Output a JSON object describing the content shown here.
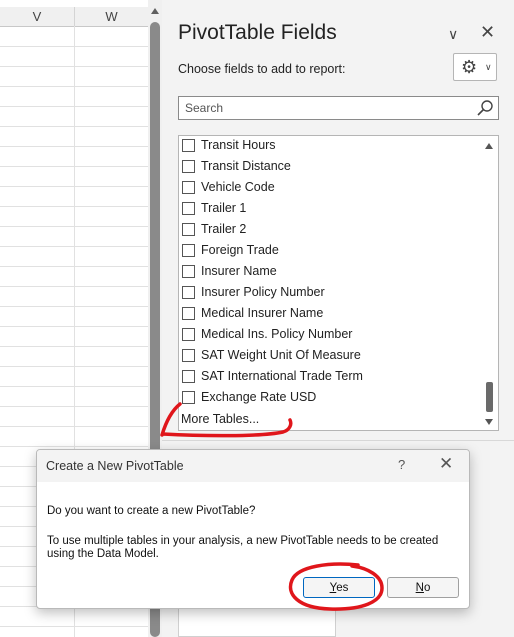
{
  "sheet": {
    "columns": [
      "V",
      "W"
    ]
  },
  "panel": {
    "title": "PivotTable Fields",
    "subtitle": "Choose fields to add to report:",
    "search_placeholder": "Search",
    "fields": [
      "Transit Hours",
      "Transit Distance",
      "Vehicle Code",
      "Trailer 1",
      "Trailer 2",
      "Foreign Trade",
      "Insurer Name",
      "Insurer Policy Number",
      "Medical Insurer Name",
      "Medical Ins. Policy Number",
      "SAT Weight Unit Of Measure",
      "SAT International Trade Term",
      "Exchange Rate USD"
    ],
    "more_tables": "More Tables..."
  },
  "dialog": {
    "title": "Create a New PivotTable",
    "help": "?",
    "question": "Do you want to create a new PivotTable?",
    "message": "To use multiple tables in your analysis, a new PivotTable needs to be created using the Data Model.",
    "yes_accel": "Y",
    "yes_rest": "es",
    "no_accel": "N",
    "no_rest": "o"
  },
  "colors": {
    "annotation": "#e0161b",
    "accent": "#0067c0"
  },
  "icons": {
    "panel_chevron": "chevron-down-icon",
    "panel_close": "close-icon",
    "settings": "gear-icon",
    "search": "search-icon",
    "dialog_close": "close-icon"
  }
}
